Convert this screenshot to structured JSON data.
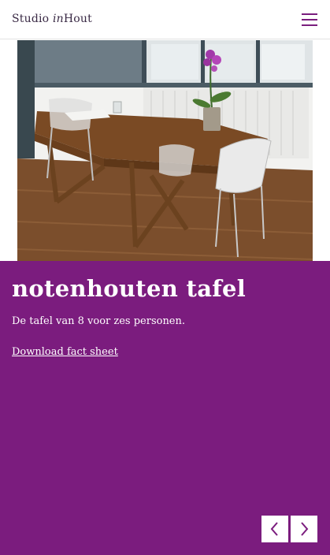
{
  "header": {
    "logo_prefix": "Studio ",
    "logo_italic": "in",
    "logo_suffix": "Hout",
    "menu_icon": "hamburger-menu-icon"
  },
  "product": {
    "title": "notenhouten tafel",
    "description": "De tafel van 8 voor zes personen.",
    "download_label": "Download fact sheet"
  },
  "carousel": {
    "prev_icon": "chevron-left-icon",
    "next_icon": "chevron-right-icon"
  },
  "colors": {
    "accent": "#7b1c7e",
    "text_on_accent": "#ffffff",
    "logo_text": "#3a2a45"
  }
}
